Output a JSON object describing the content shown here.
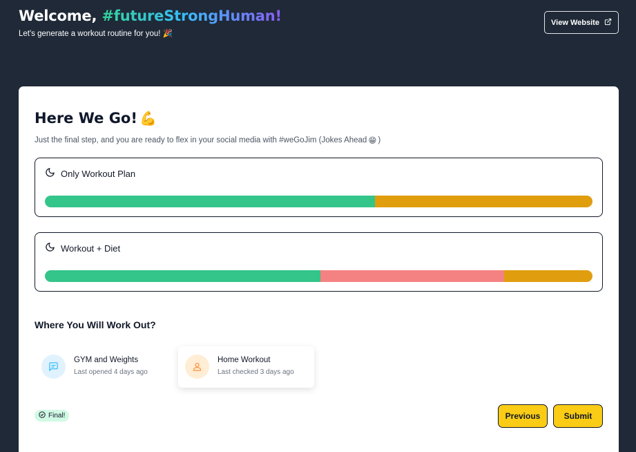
{
  "header": {
    "welcome_prefix": "Welcome, ",
    "welcome_name": "#futureStrongHuman!",
    "subtitle": "Let's generate a workout routine for you! 🎉",
    "view_website_label": "View Website"
  },
  "card": {
    "title": "Here We Go!",
    "title_emoji": "💪",
    "subtitle": "Just the final step, and you are ready to flex in your social media with #weGoJim (Jokes Ahead",
    "subtitle_emoji": "😁",
    "subtitle_end": ")"
  },
  "plans": [
    {
      "label": "Only Workout Plan",
      "icon": "moon-icon",
      "segments": [
        {
          "fraction": 0.603,
          "color": "#34c58a"
        },
        {
          "fraction": 0.397,
          "color": "#e09e0e"
        }
      ]
    },
    {
      "label": "Workout + Diet",
      "icon": "moon-icon",
      "segments": [
        {
          "fraction": 0.503,
          "color": "#34c58a"
        },
        {
          "fraction": 0.335,
          "color": "#f58282"
        },
        {
          "fraction": 0.162,
          "color": "#e09e0e"
        }
      ]
    }
  ],
  "location": {
    "title": "Where You Will Work Out?",
    "options": [
      {
        "name": "GYM and Weights",
        "meta": "Last opened 4 days ago",
        "icon": "message-icon",
        "icon_color": "#38bdf8"
      },
      {
        "name": "Home Workout",
        "meta": "Last checked 3 days ago",
        "icon": "user-icon",
        "icon_color": "#fb923c"
      }
    ]
  },
  "footer": {
    "badge_label": "Final!",
    "previous_label": "Previous",
    "submit_label": "Submit"
  }
}
